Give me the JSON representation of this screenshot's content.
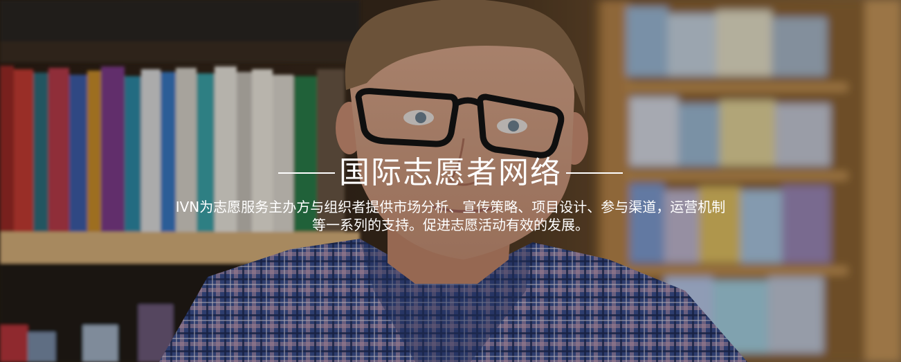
{
  "banner": {
    "title": "国际志愿者网络",
    "description_line1": "IVN为志愿服务主办方与组织者提供市场分析、宣传策略、项目设计、参与渠道，运营机制",
    "description_line2": "等一系列的支持。促进志愿活动有效的发展。"
  },
  "colors": {
    "text": "#ffffff",
    "shelf": "#b98a4e",
    "shirt_blue": "#3a4f8e",
    "glasses": "#141414"
  }
}
